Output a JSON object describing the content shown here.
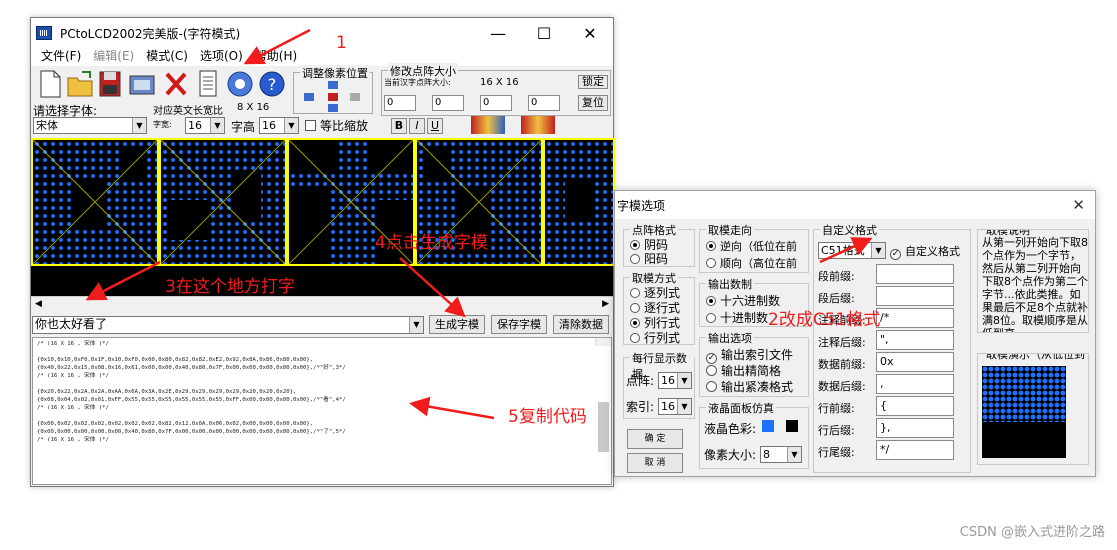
{
  "main_window": {
    "title": "PCtoLCD2002完美版-(字符模式)",
    "window_buttons": [
      "—",
      "☐",
      "✕"
    ],
    "menu": [
      "文件(F)",
      "编辑(E)",
      "模式(C)",
      "选项(O)",
      "帮助(H)"
    ],
    "toolbar": {
      "font_label": "请选择字体:",
      "font_value": "宋体",
      "ratio_label": "对应英文长宽比",
      "ratio_value": "8 X 16",
      "char_width_label": "字宽:",
      "char_width_value": "16",
      "char_height_label": "字高",
      "char_height_value": "16",
      "prop_scale_label": "等比缩放",
      "bold": "B",
      "italic": "I",
      "underline": "U",
      "adjust_pixel_label": "调整像素位置",
      "dot_size_label": "修改点阵大小",
      "current_size_label": "当前汉字点阵大小:",
      "current_size_value": "16 X 16",
      "lock_label": "锁定",
      "reset_label": "复位",
      "spin_values": [
        "0",
        "0",
        "0",
        "0"
      ]
    },
    "input_text": "你也太好看了",
    "buttons": {
      "generate": "生成字模",
      "save": "保存字模",
      "clear": "清除数据"
    },
    "code_lines": [
      "/* (16 X 16 , 宋体 )*/",
      "",
      "{0x10,0x10,0xF0,0x1F,0x10,0xF0,0x00,0x80,0x82,0x82,0xE2,0x92,0x8A,0x86,0x80,0x00},",
      "{0x40,0x22,0x15,0x08,0x16,0x61,0x00,0x00,0x40,0x80,0x7F,0x00,0x00,0x00,0x00,0x00},/*\"好\",3*/",
      "/* (16 X 16 , 宋体 )*/",
      "",
      "{0x20,0x22,0x2A,0x2A,0xAA,0x6A,0x3A,0x2E,0x29,0x29,0x29,0x29,0x20,0x20,0x20},",
      "{0x08,0x04,0x02,0x01,0xFF,0x55,0x55,0x55,0x55,0x55,0x55,0xFF,0x00,0x00,0x00,0x00},/*\"看\",4*/",
      "/* (16 X 16 , 宋体 )*/",
      "",
      "{0x00,0x02,0x02,0x02,0x02,0x02,0x02,0x82,0x12,0x0A,0x06,0x02,0x00,0x00,0x00,0x00},",
      "{0x00,0x00,0x00,0x00,0x00,0x40,0x80,0x7F,0x00,0x00,0x00,0x00,0x00,0x00,0x00,0x00},/*\"了\",5*/",
      "/* (16 X 16 , 宋体 )*/"
    ]
  },
  "dialog": {
    "title": "字模选项",
    "dot_format": {
      "label": "点阵格式",
      "options": [
        "阴码",
        "阳码"
      ],
      "selected": 0
    },
    "direction": {
      "label": "取模走向",
      "options": [
        "逆向（低位在前",
        "顺向（高位在前"
      ],
      "selected": 0
    },
    "mode": {
      "label": "取模方式",
      "options": [
        "逐列式",
        "逐行式",
        "列行式",
        "行列式"
      ],
      "selected": 2
    },
    "output_numeral": {
      "label": "输出数制",
      "options": [
        "十六进制数",
        "十进制数"
      ],
      "selected": 0
    },
    "output_options": {
      "label": "输出选项",
      "items": [
        {
          "text": "输出索引文件",
          "checked": true
        },
        {
          "text": "输出精简格",
          "checked": false
        },
        {
          "text": "输出紧凑格式",
          "checked": false
        }
      ]
    },
    "per_line": {
      "label": "每行显示数据",
      "dot_label": "点阵:",
      "dot_value": "16",
      "index_label": "索引:",
      "index_value": "16"
    },
    "lcd_sim": {
      "label": "液晶面板仿真",
      "color_label": "液晶色彩:",
      "pixel_label": "像素大小:",
      "pixel_value": "8",
      "on_color": "#1a72ff",
      "off_color": "#000000"
    },
    "ok": "确 定",
    "cancel": "取 消",
    "custom": {
      "label": "自定义格式",
      "format_value": "C51格式",
      "custom_check": "自定义格式",
      "fields": [
        {
          "label": "段前缀:",
          "value": ""
        },
        {
          "label": "段后缀:",
          "value": ""
        },
        {
          "label": "注释前缀:",
          "value": "/*"
        },
        {
          "label": "注释后缀:",
          "value": "\","
        },
        {
          "label": "数据前缀:",
          "value": "0x"
        },
        {
          "label": "数据后缀:",
          "value": ","
        },
        {
          "label": "行前缀:",
          "value": "{"
        },
        {
          "label": "行后缀:",
          "value": "},"
        },
        {
          "label": "行尾缀:",
          "value": "*/"
        }
      ]
    },
    "explain": {
      "label": "取模说明",
      "text": "从第一列开始向下取8个点作为一个字节，然后从第二列开始向下取8个点作为第二个字节...依此类推。如果最后不足8个点就补满8位。取模顺序是从低到高"
    },
    "demo_label": "取模演示（从低位到"
  },
  "annotations": {
    "a1": "1",
    "a2": "2改成C51格式",
    "a3": "3在这个地方打字",
    "a4": "4点击生成字模",
    "a5": "5复制代码"
  },
  "watermark": "CSDN @嵌入式进阶之路"
}
